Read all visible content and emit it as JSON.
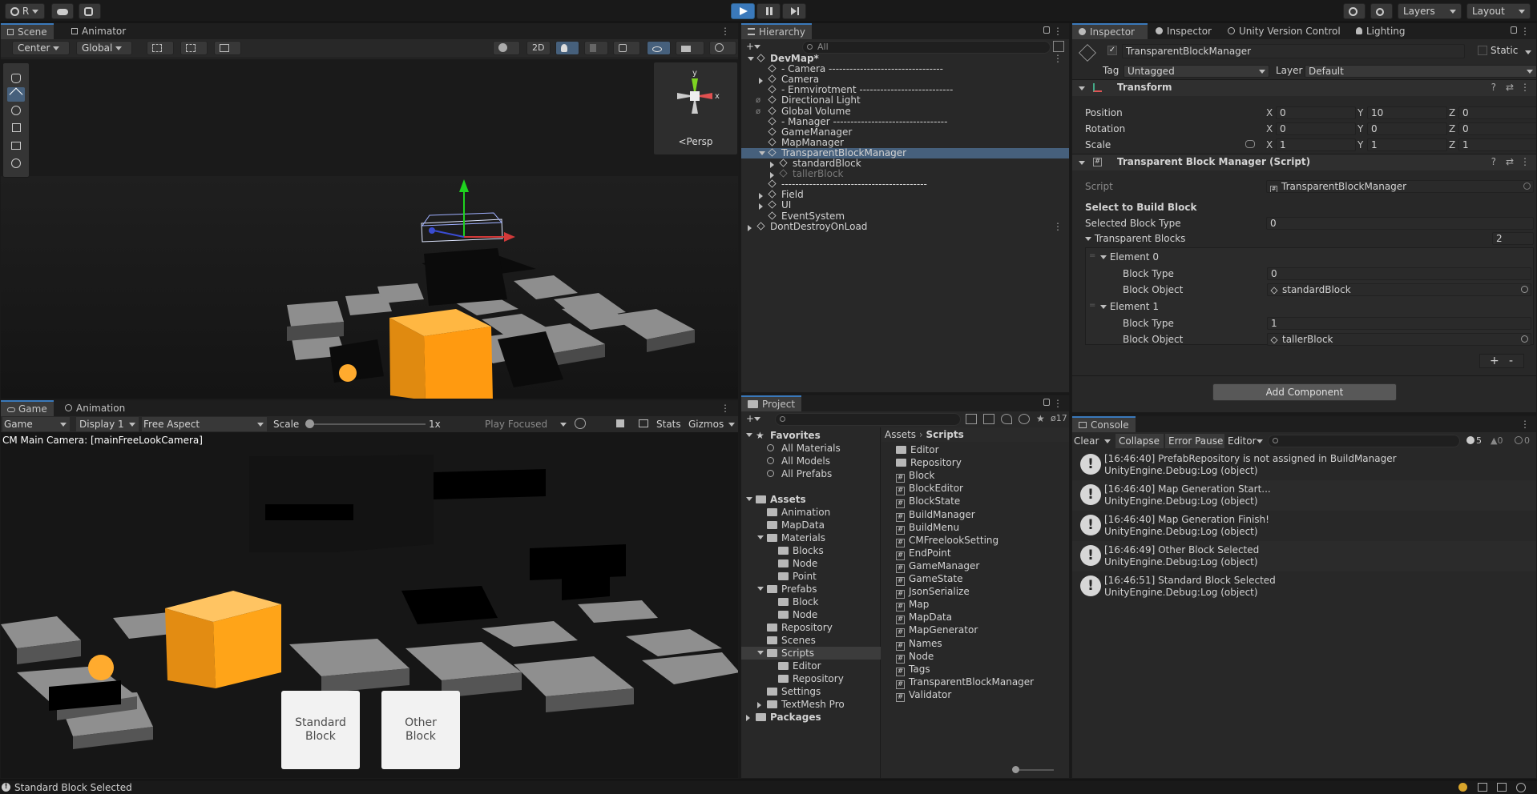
{
  "toolbar": {
    "account_label": "R",
    "layers_label": "Layers",
    "layout_label": "Layout"
  },
  "scene": {
    "tab_scene": "Scene",
    "tab_animator": "Animator",
    "pivot_mode": "Center",
    "space_mode": "Global",
    "btn_2d": "2D",
    "persp_label": "Persp"
  },
  "game": {
    "tab_game": "Game",
    "tab_animation": "Animation",
    "view_select": "Game",
    "display_select": "Display 1",
    "aspect_select": "Free Aspect",
    "scale_label": "Scale",
    "scale_value": "1x",
    "scale_fraction": 0.0,
    "play_focused": "Play Focused",
    "stats_label": "Stats",
    "gizmos_label": "Gizmos",
    "camera_label": "CM Main Camera: [mainFreeLookCamera]",
    "button_standard": "Standard\nBlock",
    "button_other": "Other\nBlock"
  },
  "hierarchy": {
    "title": "Hierarchy",
    "search_placeholder": "All",
    "items": [
      {
        "label": "DevMap*",
        "depth": 0,
        "bold": true
      },
      {
        "label": "- Camera ---------------------------------",
        "depth": 1
      },
      {
        "label": "Camera",
        "depth": 1
      },
      {
        "label": "- Enmvirotment ---------------------------",
        "depth": 1
      },
      {
        "label": "Directional Light",
        "depth": 1
      },
      {
        "label": "Global Volume",
        "depth": 1
      },
      {
        "label": "- Manager ---------------------------------",
        "depth": 1
      },
      {
        "label": "GameManager",
        "depth": 1
      },
      {
        "label": "MapManager",
        "depth": 1
      },
      {
        "label": "TransparentBlockManager",
        "depth": 1,
        "selected": true
      },
      {
        "label": "standardBlock",
        "depth": 2
      },
      {
        "label": "tallerBlock",
        "depth": 2,
        "dim": true
      },
      {
        "label": "------------------------------------------",
        "depth": 1
      },
      {
        "label": "Field",
        "depth": 1
      },
      {
        "label": "UI",
        "depth": 1
      },
      {
        "label": "EventSystem",
        "depth": 1
      },
      {
        "label": "DontDestroyOnLoad",
        "depth": 0
      }
    ]
  },
  "project": {
    "title": "Project",
    "hidden_count": "17",
    "breadcrumb_root": "Assets",
    "breadcrumb_current": "Scripts",
    "tree": [
      {
        "label": "Favorites",
        "depth": 0,
        "bold": true
      },
      {
        "label": "All Materials",
        "depth": 1
      },
      {
        "label": "All Models",
        "depth": 1
      },
      {
        "label": "All Prefabs",
        "depth": 1
      },
      {
        "label": "",
        "depth": 0
      },
      {
        "label": "Assets",
        "depth": 0,
        "bold": true
      },
      {
        "label": "Animation",
        "depth": 1
      },
      {
        "label": "MapData",
        "depth": 1
      },
      {
        "label": "Materials",
        "depth": 1
      },
      {
        "label": "Blocks",
        "depth": 2
      },
      {
        "label": "Node",
        "depth": 2
      },
      {
        "label": "Point",
        "depth": 2
      },
      {
        "label": "Prefabs",
        "depth": 1
      },
      {
        "label": "Block",
        "depth": 2
      },
      {
        "label": "Node",
        "depth": 2
      },
      {
        "label": "Repository",
        "depth": 1
      },
      {
        "label": "Scenes",
        "depth": 1
      },
      {
        "label": "Scripts",
        "depth": 1,
        "selected": true
      },
      {
        "label": "Editor",
        "depth": 2
      },
      {
        "label": "Repository",
        "depth": 2
      },
      {
        "label": "Settings",
        "depth": 1
      },
      {
        "label": "TextMesh Pro",
        "depth": 1
      },
      {
        "label": "Packages",
        "depth": 0,
        "bold": true
      }
    ],
    "files": [
      {
        "label": "Editor",
        "kind": "folder"
      },
      {
        "label": "Repository",
        "kind": "folder"
      },
      {
        "label": "Block",
        "kind": "script"
      },
      {
        "label": "BlockEditor",
        "kind": "script"
      },
      {
        "label": "BlockState",
        "kind": "script"
      },
      {
        "label": "BuildManager",
        "kind": "script"
      },
      {
        "label": "BuildMenu",
        "kind": "script"
      },
      {
        "label": "CMFreelookSetting",
        "kind": "script"
      },
      {
        "label": "EndPoint",
        "kind": "script"
      },
      {
        "label": "GameManager",
        "kind": "script"
      },
      {
        "label": "GameState",
        "kind": "script"
      },
      {
        "label": "JsonSerialize",
        "kind": "script"
      },
      {
        "label": "Map",
        "kind": "script"
      },
      {
        "label": "MapData",
        "kind": "script"
      },
      {
        "label": "MapGenerator",
        "kind": "script"
      },
      {
        "label": "Names",
        "kind": "script"
      },
      {
        "label": "Node",
        "kind": "script"
      },
      {
        "label": "Tags",
        "kind": "script"
      },
      {
        "label": "TransparentBlockManager",
        "kind": "script"
      },
      {
        "label": "Validator",
        "kind": "script"
      }
    ]
  },
  "inspector": {
    "tabs": [
      "Inspector",
      "Inspector",
      "Unity Version Control",
      "Lighting"
    ],
    "object_name": "TransparentBlockManager",
    "static_label": "Static",
    "tag_label": "Tag",
    "tag_value": "Untagged",
    "layer_label": "Layer",
    "layer_value": "Default",
    "transform": {
      "title": "Transform",
      "position_label": "Position",
      "rotation_label": "Rotation",
      "scale_label": "Scale",
      "position": [
        "0",
        "10",
        "0"
      ],
      "rotation": [
        "0",
        "0",
        "0"
      ],
      "scale": [
        "1",
        "1",
        "1"
      ]
    },
    "script_component": {
      "title": "Transparent Block Manager (Script)",
      "script_label": "Script",
      "script_value": "TransparentBlockManager",
      "header": "Select to Build Block",
      "selected_type_label": "Selected Block Type",
      "selected_type_value": "0",
      "blocks_label": "Transparent Blocks",
      "blocks_count": "2",
      "element0_label": "Element 0",
      "element1_label": "Element 1",
      "block_type_label": "Block Type",
      "block_object_label": "Block Object",
      "e0_type": "0",
      "e0_object": "standardBlock",
      "e1_type": "1",
      "e1_object": "tallerBlock",
      "plus": "+",
      "minus": "-"
    },
    "add_component": "Add Component"
  },
  "console": {
    "title": "Console",
    "clear": "Clear",
    "collapse": "Collapse",
    "error_pause": "Error Pause",
    "editor": "Editor",
    "count_log": "5",
    "count_warn": "0",
    "count_err": "0",
    "entries": [
      {
        "line1": "[16:46:40] PrefabRepository is not assigned in BuildManager",
        "line2": "UnityEngine.Debug:Log (object)"
      },
      {
        "line1": "[16:46:40] Map Generation Start...",
        "line2": "UnityEngine.Debug:Log (object)"
      },
      {
        "line1": "[16:46:40] Map Generation Finish!",
        "line2": "UnityEngine.Debug:Log (object)"
      },
      {
        "line1": "[16:46:49] Other Block Selected",
        "line2": "UnityEngine.Debug:Log (object)"
      },
      {
        "line1": "[16:46:51] Standard Block Selected",
        "line2": "UnityEngine.Debug:Log (object)"
      }
    ]
  },
  "status_bar": {
    "message": "Standard Block Selected"
  },
  "colors": {
    "accent": "#3a79bb",
    "selection": "#2c5d87",
    "orange_block": "#ff9a10",
    "background": "#191919"
  }
}
